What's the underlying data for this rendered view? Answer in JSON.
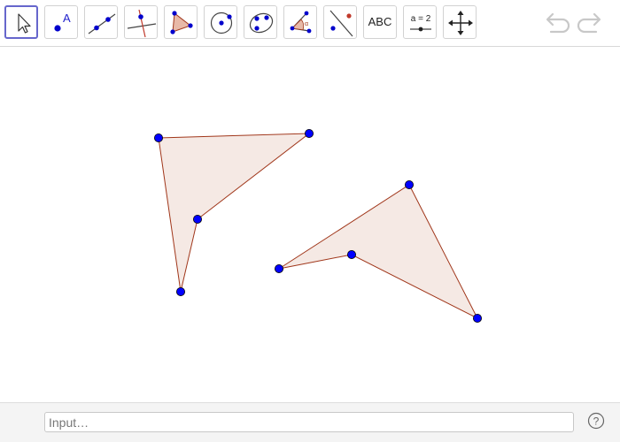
{
  "toolbar": {
    "tools": [
      {
        "name": "move",
        "icon": "arrow-pointer-icon",
        "active": true
      },
      {
        "name": "point",
        "icon": "point-label-icon",
        "label": "A"
      },
      {
        "name": "line",
        "icon": "line-through-points-icon"
      },
      {
        "name": "perpendicular-line",
        "icon": "perpendicular-line-icon"
      },
      {
        "name": "polygon",
        "icon": "polygon-icon"
      },
      {
        "name": "circle",
        "icon": "circle-center-point-icon"
      },
      {
        "name": "conic",
        "icon": "conic-through-points-icon"
      },
      {
        "name": "angle",
        "icon": "angle-icon"
      },
      {
        "name": "reflect",
        "icon": "reflect-about-line-icon"
      },
      {
        "name": "text",
        "icon": "text-icon",
        "label": "ABC"
      },
      {
        "name": "slider",
        "icon": "slider-icon",
        "label": "a = 2"
      },
      {
        "name": "move-graphics-view",
        "icon": "move-arrows-icon"
      }
    ],
    "undo_icon": "undo-icon",
    "redo_icon": "redo-icon"
  },
  "colors": {
    "point_fill": "#0000ff",
    "point_stroke": "#000000",
    "polygon_fill": "#f5e9e4",
    "polygon_stroke": "#a0361a",
    "active_tool_border": "#6666cc",
    "icon_gray": "#c8c8c8"
  },
  "input_bar": {
    "placeholder": "Input…",
    "help_icon": "help-icon",
    "help_label": "?"
  }
}
